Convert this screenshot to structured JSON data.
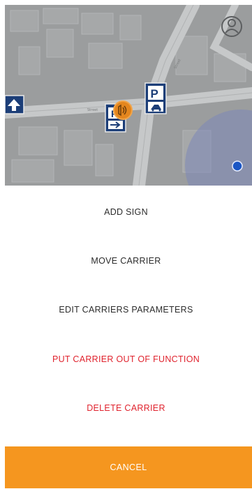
{
  "map": {
    "street_label_1": "Street",
    "street_label_2": "Street",
    "icons": [
      "user-avatar-icon",
      "one-way-arrow-sign-icon",
      "parking-sign-icon",
      "selected-carrier-sign-icon",
      "location-dot-icon"
    ]
  },
  "menu": {
    "add_sign": "ADD SIGN",
    "move_carrier": "MOVE CARRIER",
    "edit_carrier": "EDIT CARRIERS PARAMETERS",
    "out_of_function": "PUT CARRIER OUT OF FUNCTION",
    "delete_carrier": "DELETE CARRIER"
  },
  "cancel_label": "CANCEL",
  "colors": {
    "accent": "#f5961f",
    "danger": "#e0232e",
    "sign_blue": "#1c3e78",
    "location_blue": "#1b56c4"
  }
}
